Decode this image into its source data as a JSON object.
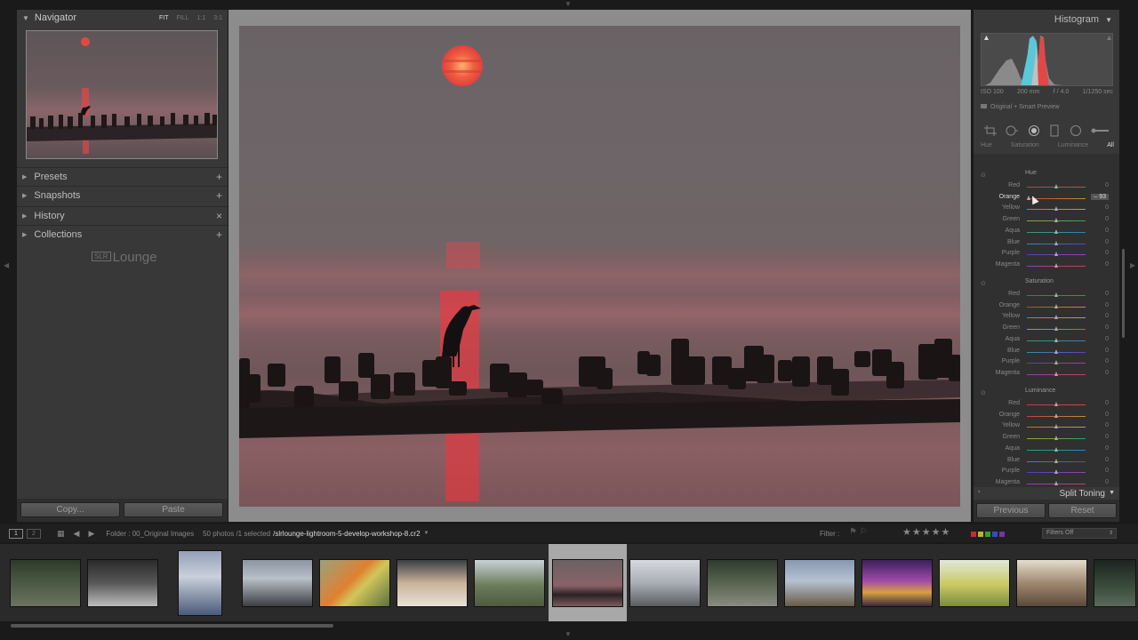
{
  "navigator": {
    "title": "Navigator",
    "zoom_options": [
      "FIT",
      "FILL",
      "1:1",
      "3:1"
    ],
    "active_zoom": "FIT"
  },
  "left_sections": [
    {
      "label": "Presets",
      "action": "+"
    },
    {
      "label": "Snapshots",
      "action": "+"
    },
    {
      "label": "History",
      "action": "×"
    },
    {
      "label": "Collections",
      "action": "+"
    }
  ],
  "brand": {
    "box": "SLR",
    "text": "Lounge"
  },
  "left_buttons": {
    "copy": "Copy...",
    "paste": "Paste"
  },
  "histogram": {
    "title": "Histogram",
    "iso": "ISO 100",
    "focal": "200 mm",
    "aperture": "f / 4.0",
    "shutter": "1/1250 sec",
    "preview": "Original + Smart Preview"
  },
  "hsl_tabs": [
    "Hue",
    "Saturation",
    "Luminance",
    "All"
  ],
  "active_tab": "All",
  "hsl_groups": [
    {
      "title": "Hue",
      "rows": [
        {
          "label": "Red",
          "value": "0",
          "fraction": 0.5
        },
        {
          "label": "Orange",
          "value": "– 93",
          "fraction": 0.035,
          "active": true
        },
        {
          "label": "Yellow",
          "value": "0",
          "fraction": 0.5
        },
        {
          "label": "Green",
          "value": "0",
          "fraction": 0.5
        },
        {
          "label": "Aqua",
          "value": "0",
          "fraction": 0.5
        },
        {
          "label": "Blue",
          "value": "0",
          "fraction": 0.5
        },
        {
          "label": "Purple",
          "value": "0",
          "fraction": 0.5
        },
        {
          "label": "Magenta",
          "value": "0",
          "fraction": 0.5
        }
      ]
    },
    {
      "title": "Saturation",
      "rows": [
        {
          "label": "Red",
          "value": "0",
          "fraction": 0.5
        },
        {
          "label": "Orange",
          "value": "0",
          "fraction": 0.5
        },
        {
          "label": "Yellow",
          "value": "0",
          "fraction": 0.5
        },
        {
          "label": "Green",
          "value": "0",
          "fraction": 0.5
        },
        {
          "label": "Aqua",
          "value": "0",
          "fraction": 0.5
        },
        {
          "label": "Blue",
          "value": "0",
          "fraction": 0.5
        },
        {
          "label": "Purple",
          "value": "0",
          "fraction": 0.5
        },
        {
          "label": "Magenta",
          "value": "0",
          "fraction": 0.5
        }
      ]
    },
    {
      "title": "Luminance",
      "rows": [
        {
          "label": "Red",
          "value": "0",
          "fraction": 0.5
        },
        {
          "label": "Orange",
          "value": "0",
          "fraction": 0.5
        },
        {
          "label": "Yellow",
          "value": "0",
          "fraction": 0.5
        },
        {
          "label": "Green",
          "value": "0",
          "fraction": 0.5
        },
        {
          "label": "Aqua",
          "value": "0",
          "fraction": 0.5
        },
        {
          "label": "Blue",
          "value": "0",
          "fraction": 0.5
        },
        {
          "label": "Purple",
          "value": "0",
          "fraction": 0.5
        },
        {
          "label": "Magenta",
          "value": "0",
          "fraction": 0.5
        }
      ]
    }
  ],
  "split_toning": "Split Toning",
  "right_buttons": {
    "previous": "Previous",
    "reset": "Reset"
  },
  "filmstrip_bar": {
    "screen1": "1",
    "screen2": "2",
    "folder": "Folder : 00_Original Images",
    "count": "50 photos /1 selected",
    "path": "/slrlounge-lightroom-5-develop-workshop-8.cr2",
    "filter_label": "Filter :",
    "filters_off": "Filters Off"
  },
  "colors": {
    "label_red": "#c03030",
    "label_yellow": "#c0b030",
    "label_green": "#30a030",
    "label_blue": "#3050c0",
    "label_purple": "#8030a0"
  }
}
